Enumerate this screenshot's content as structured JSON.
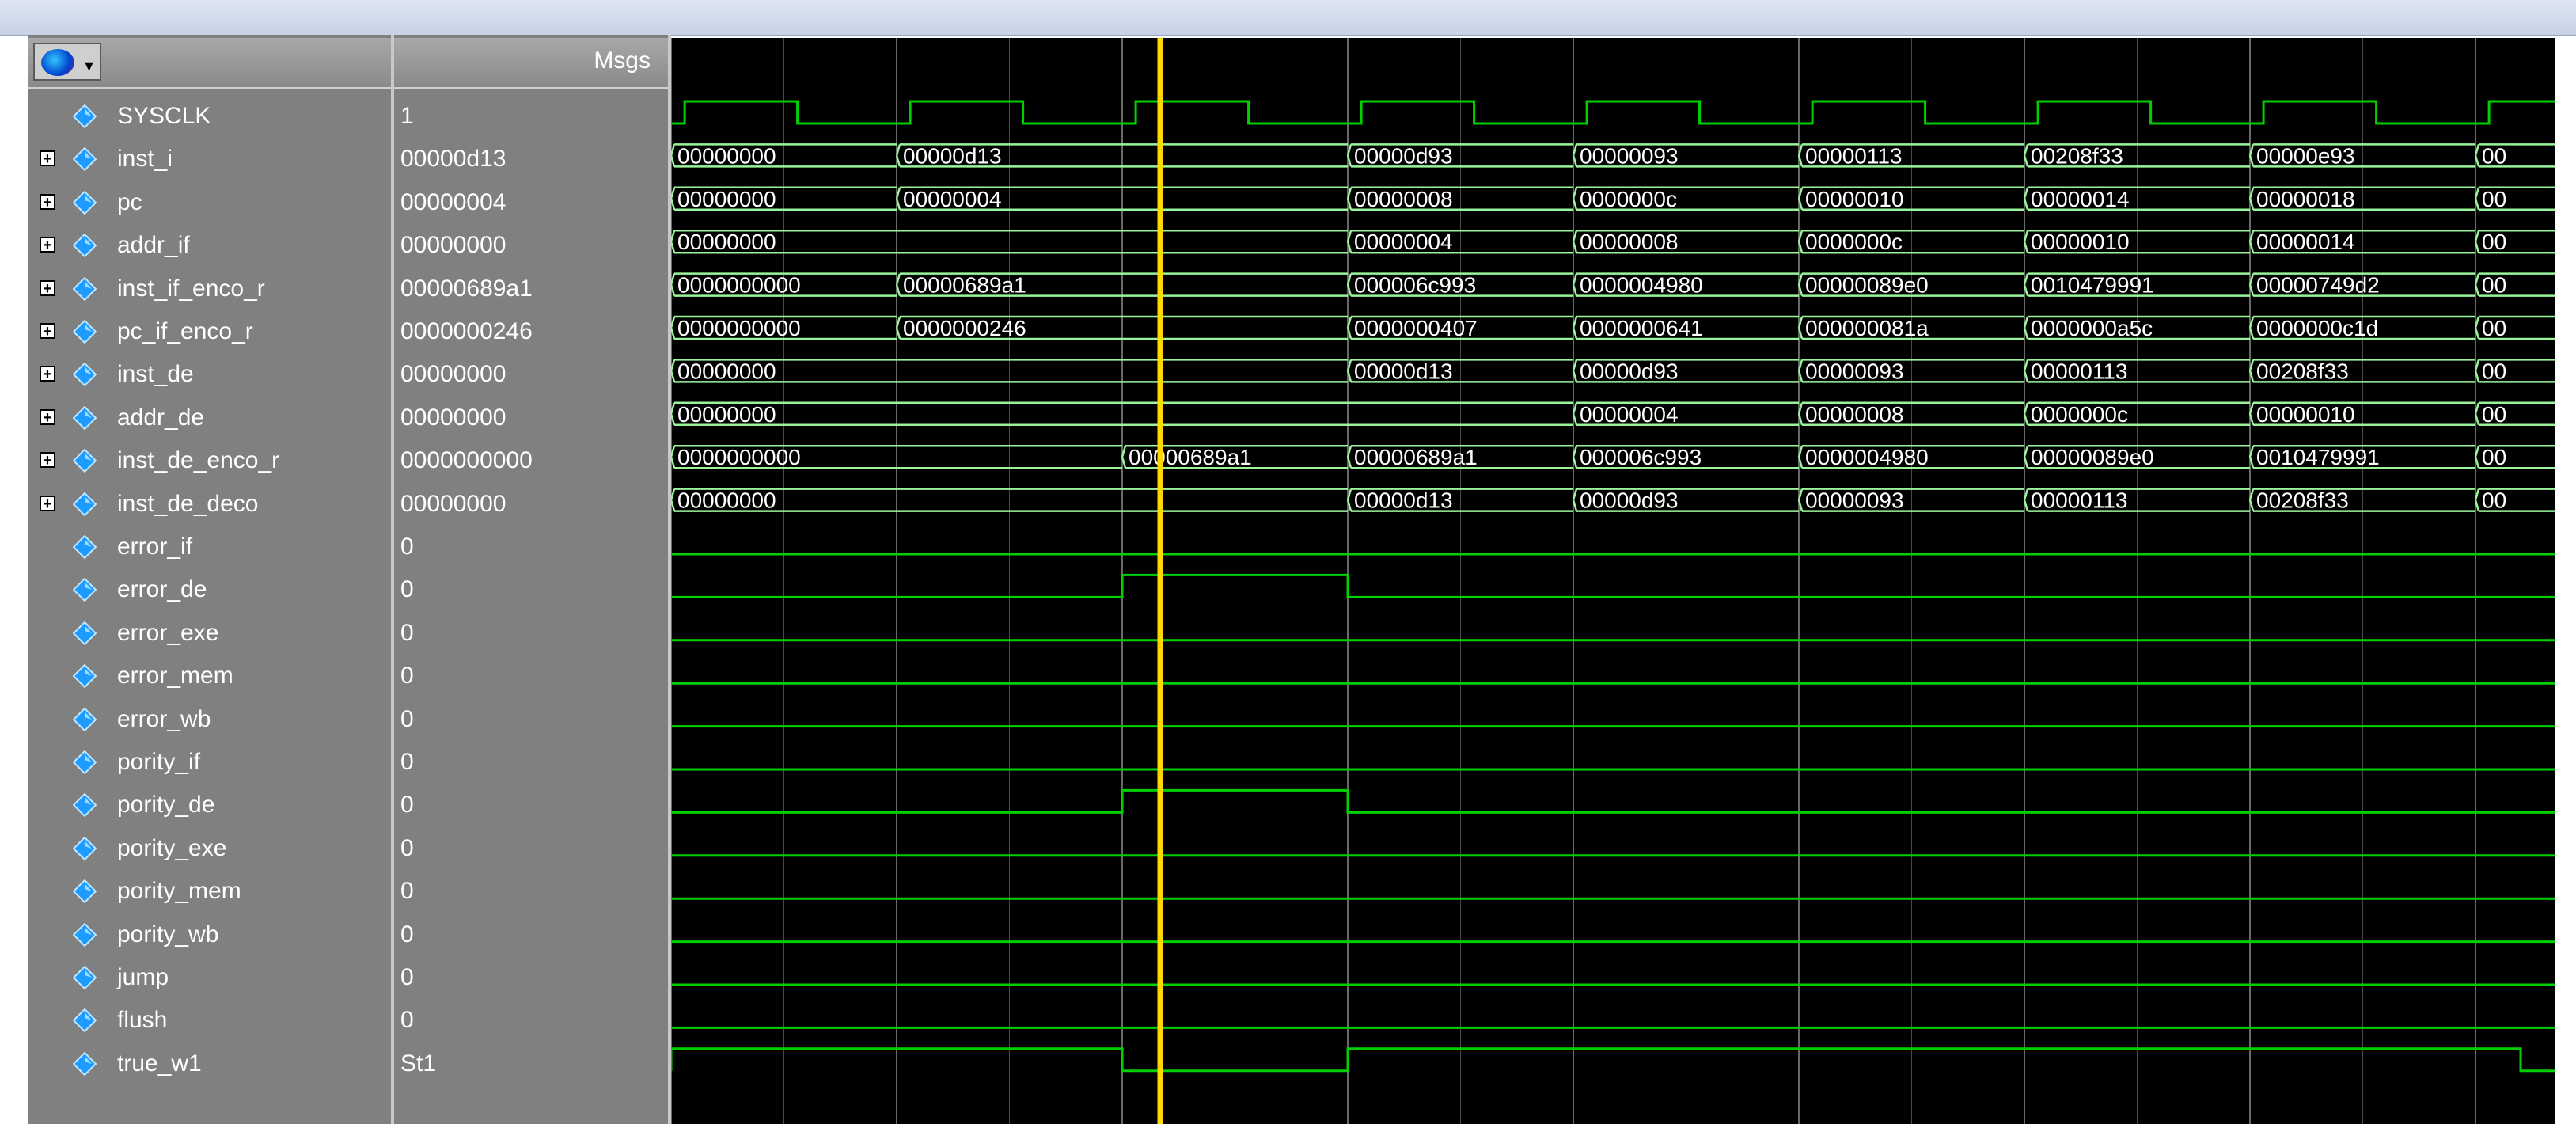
{
  "header": {
    "msgs_label": "Msgs",
    "toolbar_icon": "wave-format-icon"
  },
  "colors": {
    "wave": "#00d000",
    "cursor": "#ffd800",
    "grid": "#8a8a8a",
    "bus_text": "#ffffff"
  },
  "cursor_time_index": 4,
  "signals": [
    {
      "name": "SYSCLK",
      "value": "1",
      "kind": "clock",
      "expandable": false
    },
    {
      "name": "inst_i",
      "value": "00000d13",
      "kind": "bus",
      "expandable": true,
      "segments": [
        {
          "t": 0,
          "v": "00000000"
        },
        {
          "t": 1,
          "v": "00000d13"
        },
        {
          "t": 3,
          "v": "00000d93"
        },
        {
          "t": 4,
          "v": "00000093"
        },
        {
          "t": 5,
          "v": "00000113"
        },
        {
          "t": 6,
          "v": "00208f33"
        },
        {
          "t": 7,
          "v": "00000e93"
        },
        {
          "t": 8,
          "v": "00"
        }
      ]
    },
    {
      "name": "pc",
      "value": "00000004",
      "kind": "bus",
      "expandable": true,
      "segments": [
        {
          "t": 0,
          "v": "00000000"
        },
        {
          "t": 1,
          "v": "00000004"
        },
        {
          "t": 3,
          "v": "00000008"
        },
        {
          "t": 4,
          "v": "0000000c"
        },
        {
          "t": 5,
          "v": "00000010"
        },
        {
          "t": 6,
          "v": "00000014"
        },
        {
          "t": 7,
          "v": "00000018"
        },
        {
          "t": 8,
          "v": "00"
        }
      ]
    },
    {
      "name": "addr_if",
      "value": "00000000",
      "kind": "bus",
      "expandable": true,
      "segments": [
        {
          "t": 0,
          "v": "00000000"
        },
        {
          "t": 3,
          "v": "00000004"
        },
        {
          "t": 4,
          "v": "00000008"
        },
        {
          "t": 5,
          "v": "0000000c"
        },
        {
          "t": 6,
          "v": "00000010"
        },
        {
          "t": 7,
          "v": "00000014"
        },
        {
          "t": 8,
          "v": "00"
        }
      ]
    },
    {
      "name": "inst_if_enco_r",
      "value": "00000689a1",
      "kind": "bus",
      "expandable": true,
      "segments": [
        {
          "t": 0,
          "v": "0000000000"
        },
        {
          "t": 1,
          "v": "00000689a1"
        },
        {
          "t": 3,
          "v": "000006c993"
        },
        {
          "t": 4,
          "v": "0000004980"
        },
        {
          "t": 5,
          "v": "00000089e0"
        },
        {
          "t": 6,
          "v": "0010479991"
        },
        {
          "t": 7,
          "v": "00000749d2"
        },
        {
          "t": 8,
          "v": "00"
        }
      ]
    },
    {
      "name": "pc_if_enco_r",
      "value": "0000000246",
      "kind": "bus",
      "expandable": true,
      "segments": [
        {
          "t": 0,
          "v": "0000000000"
        },
        {
          "t": 1,
          "v": "0000000246"
        },
        {
          "t": 3,
          "v": "0000000407"
        },
        {
          "t": 4,
          "v": "0000000641"
        },
        {
          "t": 5,
          "v": "000000081a"
        },
        {
          "t": 6,
          "v": "0000000a5c"
        },
        {
          "t": 7,
          "v": "0000000c1d"
        },
        {
          "t": 8,
          "v": "00"
        }
      ]
    },
    {
      "name": "inst_de",
      "value": "00000000",
      "kind": "bus",
      "expandable": true,
      "segments": [
        {
          "t": 0,
          "v": "00000000"
        },
        {
          "t": 3,
          "v": "00000d13"
        },
        {
          "t": 4,
          "v": "00000d93"
        },
        {
          "t": 5,
          "v": "00000093"
        },
        {
          "t": 6,
          "v": "00000113"
        },
        {
          "t": 7,
          "v": "00208f33"
        },
        {
          "t": 8,
          "v": "00"
        }
      ]
    },
    {
      "name": "addr_de",
      "value": "00000000",
      "kind": "bus",
      "expandable": true,
      "segments": [
        {
          "t": 0,
          "v": "00000000"
        },
        {
          "t": 4,
          "v": "00000004"
        },
        {
          "t": 5,
          "v": "00000008"
        },
        {
          "t": 6,
          "v": "0000000c"
        },
        {
          "t": 7,
          "v": "00000010"
        },
        {
          "t": 8,
          "v": "00"
        }
      ]
    },
    {
      "name": "inst_de_enco_r",
      "value": "0000000000",
      "kind": "bus",
      "expandable": true,
      "segments": [
        {
          "t": 0,
          "v": "0000000000"
        },
        {
          "t": 2,
          "v": "00000689a1"
        },
        {
          "t": 3,
          "v": "00000689a1"
        },
        {
          "t": 4,
          "v": "000006c993"
        },
        {
          "t": 5,
          "v": "0000004980"
        },
        {
          "t": 6,
          "v": "00000089e0"
        },
        {
          "t": 7,
          "v": "0010479991"
        },
        {
          "t": 8,
          "v": "00"
        }
      ]
    },
    {
      "name": "inst_de_deco",
      "value": "00000000",
      "kind": "bus",
      "expandable": true,
      "segments": [
        {
          "t": 0,
          "v": "00000000"
        },
        {
          "t": 3,
          "v": "00000d13"
        },
        {
          "t": 4,
          "v": "00000d93"
        },
        {
          "t": 5,
          "v": "00000093"
        },
        {
          "t": 6,
          "v": "00000113"
        },
        {
          "t": 7,
          "v": "00208f33"
        },
        {
          "t": 8,
          "v": "00"
        }
      ]
    },
    {
      "name": "error_if",
      "value": "0",
      "kind": "bit",
      "expandable": false,
      "high": []
    },
    {
      "name": "error_de",
      "value": "0",
      "kind": "bit",
      "expandable": false,
      "high": [
        [
          2,
          3
        ]
      ]
    },
    {
      "name": "error_exe",
      "value": "0",
      "kind": "bit",
      "expandable": false,
      "high": []
    },
    {
      "name": "error_mem",
      "value": "0",
      "kind": "bit",
      "expandable": false,
      "high": []
    },
    {
      "name": "error_wb",
      "value": "0",
      "kind": "bit",
      "expandable": false,
      "high": []
    },
    {
      "name": "pority_if",
      "value": "0",
      "kind": "bit",
      "expandable": false,
      "high": []
    },
    {
      "name": "pority_de",
      "value": "0",
      "kind": "bit",
      "expandable": false,
      "high": [
        [
          2,
          3
        ]
      ]
    },
    {
      "name": "pority_exe",
      "value": "0",
      "kind": "bit",
      "expandable": false,
      "high": []
    },
    {
      "name": "pority_mem",
      "value": "0",
      "kind": "bit",
      "expandable": false,
      "high": []
    },
    {
      "name": "pority_wb",
      "value": "0",
      "kind": "bit",
      "expandable": false,
      "high": []
    },
    {
      "name": "jump",
      "value": "0",
      "kind": "bit",
      "expandable": false,
      "high": []
    },
    {
      "name": "flush",
      "value": "0",
      "kind": "bit",
      "expandable": false,
      "high": []
    },
    {
      "name": "true_w1",
      "value": "St1",
      "kind": "bit",
      "expandable": false,
      "high": [
        [
          0,
          2
        ],
        [
          3,
          8.2
        ]
      ]
    }
  ]
}
